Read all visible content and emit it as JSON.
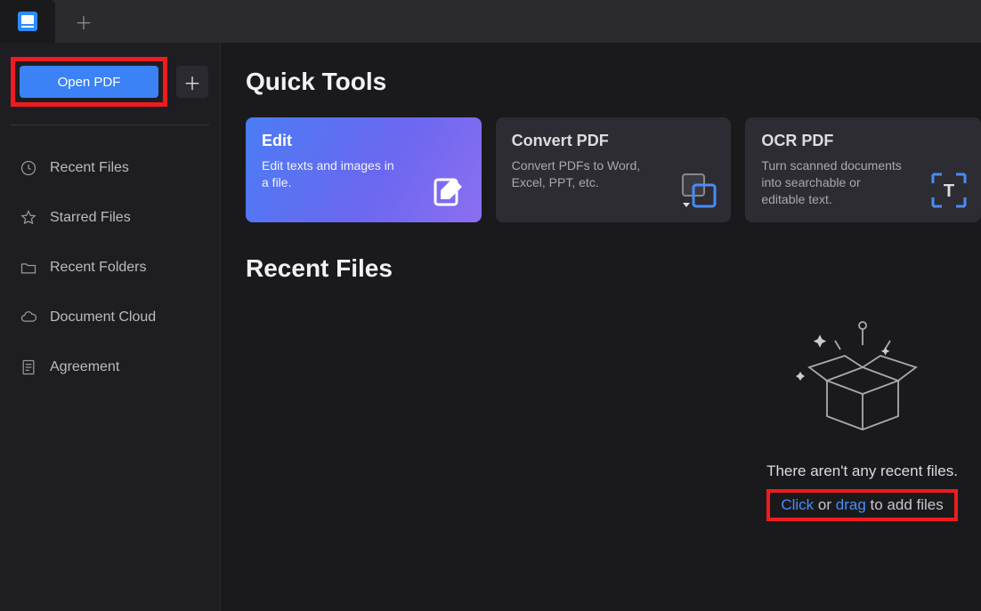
{
  "titlebar": {
    "app_icon": "pdfelement-logo"
  },
  "sidebar": {
    "open_pdf_label": "Open PDF",
    "nav": [
      {
        "icon": "clock-icon",
        "label": "Recent Files"
      },
      {
        "icon": "star-icon",
        "label": "Starred Files"
      },
      {
        "icon": "folder-icon",
        "label": "Recent Folders"
      },
      {
        "icon": "cloud-icon",
        "label": "Document Cloud"
      },
      {
        "icon": "document-icon",
        "label": "Agreement"
      }
    ]
  },
  "main": {
    "quick_tools_title": "Quick Tools",
    "tools": [
      {
        "title": "Edit",
        "desc": "Edit texts and images in a file."
      },
      {
        "title": "Convert PDF",
        "desc": "Convert PDFs to Word, Excel, PPT, etc."
      },
      {
        "title": "OCR PDF",
        "desc": "Turn scanned documents into searchable or editable text."
      }
    ],
    "recent_files_title": "Recent Files",
    "empty_message": "There aren't any recent files.",
    "drop_hint": {
      "click": "Click",
      "or": " or ",
      "drag": "drag",
      "rest": " to add files"
    }
  }
}
